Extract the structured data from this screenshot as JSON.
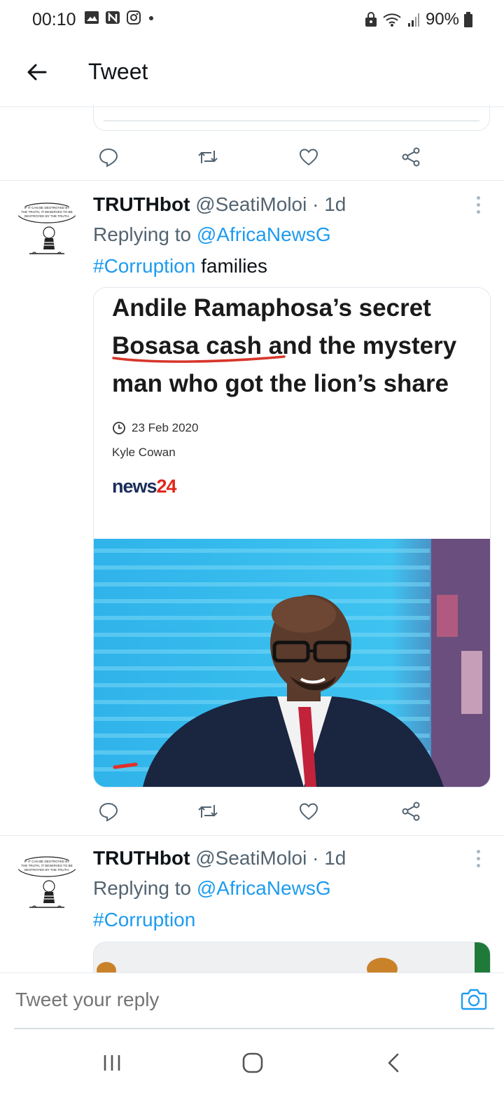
{
  "status_bar": {
    "time": "00:10",
    "battery": "90%"
  },
  "header": {
    "title": "Tweet"
  },
  "tweets": [
    {
      "name": "TRUTHbot",
      "handle": "@SeatiMoloi · 1d",
      "replying_prefix": "Replying to ",
      "replying_to": "@AfricaNewsG",
      "hashtag": "#Corruption",
      "text_rest": " families",
      "avatar_caption": "If it can be destroyed by the truth, it deserves to be destroyed by the truth.",
      "card": {
        "headline": "Andile Ramaphosa’s secret Bosasa cash and the mystery man who got the lion’s share",
        "date": "23 Feb 2020",
        "author": "Kyle Cowan",
        "logo_main": "news",
        "logo_num": "24"
      }
    },
    {
      "name": "TRUTHbot",
      "handle": "@SeatiMoloi · 1d",
      "replying_prefix": "Replying to ",
      "replying_to": "@AfricaNewsG",
      "hashtag": "#Corruption",
      "avatar_caption": "If it can be destroyed by the truth, it deserves to be destroyed by the truth."
    }
  ],
  "reply": {
    "placeholder": "Tweet your reply"
  },
  "icons": {
    "back": "back-arrow-icon",
    "reply": "reply-icon",
    "retweet": "retweet-icon",
    "like": "heart-icon",
    "share": "share-icon",
    "more": "more-vertical-icon",
    "camera": "camera-icon",
    "recents": "recents-icon",
    "home": "home-icon",
    "nav_back": "nav-back-icon"
  },
  "colors": {
    "link": "#1d9bf0",
    "text": "#0f1419",
    "secondary": "#536471",
    "news24_blue": "#1b2d5b",
    "news24_red": "#e1271b"
  }
}
